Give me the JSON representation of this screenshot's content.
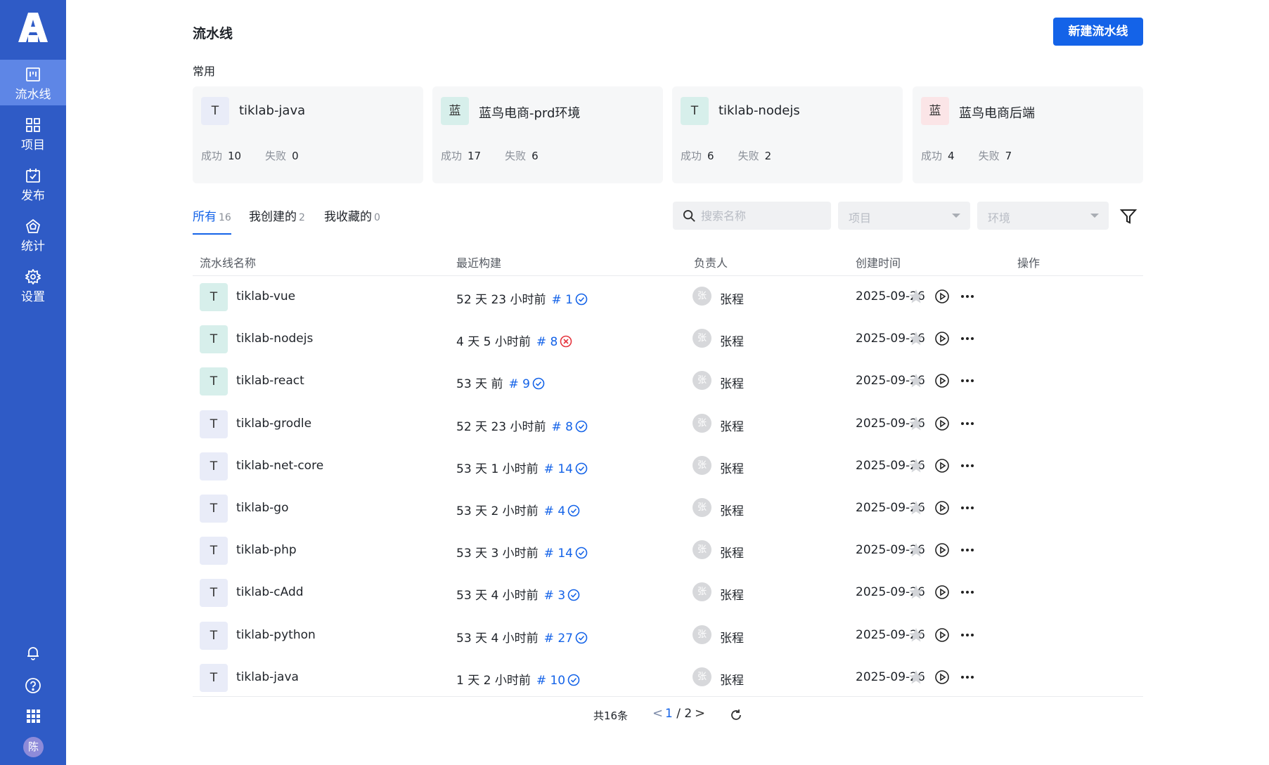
{
  "sidebar": {
    "logo": "logo-icon",
    "items": [
      {
        "label": "流水线",
        "icon": "pipeline-icon",
        "active": true
      },
      {
        "label": "项目",
        "icon": "project-grid-icon"
      },
      {
        "label": "发布",
        "icon": "release-calendar-icon"
      },
      {
        "label": "统计",
        "icon": "statistics-icon"
      },
      {
        "label": "设置",
        "icon": "gear-icon"
      }
    ],
    "bottom": [
      "bell-icon",
      "help-icon",
      "apps-grid-icon"
    ],
    "user_avatar": "陈"
  },
  "header": {
    "title": "流水线",
    "new_button": "新建流水线"
  },
  "favorites": {
    "label": "常用",
    "success_label": "成功",
    "fail_label": "失败",
    "cards": [
      {
        "initial": "T",
        "name": "tiklab-java",
        "success": "10",
        "fail": "0",
        "color": "#e9ecf8"
      },
      {
        "initial": "蓝",
        "name": "蓝鸟电商-prd环境",
        "success": "17",
        "fail": "6",
        "color": "#d7efeb"
      },
      {
        "initial": "T",
        "name": "tiklab-nodejs",
        "success": "6",
        "fail": "2",
        "color": "#d7efeb"
      },
      {
        "initial": "蓝",
        "name": "蓝鸟电商后端",
        "success": "4",
        "fail": "7",
        "color": "#fbe5e7"
      }
    ]
  },
  "tabs": [
    {
      "label": "所有",
      "count": "16",
      "active": true
    },
    {
      "label": "我创建的",
      "count": "2"
    },
    {
      "label": "我收藏的",
      "count": "0"
    }
  ],
  "filters": {
    "search_placeholder": "搜索名称",
    "project_placeholder": "项目",
    "env_placeholder": "环境"
  },
  "table": {
    "columns": [
      "流水线名称",
      "最近构建",
      "负责人",
      "创建时间",
      "操作"
    ],
    "rows": [
      {
        "initial": "T",
        "name": "tiklab-vue",
        "build_time": "52 天 23 小时前",
        "build_no": "# 1",
        "status": "success",
        "owner_initial": "张",
        "owner": "张程",
        "created": "2025-09-26",
        "color": "#d7efeb"
      },
      {
        "initial": "T",
        "name": "tiklab-nodejs",
        "build_time": "4 天 5 小时前",
        "build_no": "# 8",
        "status": "fail",
        "owner_initial": "张",
        "owner": "张程",
        "created": "2025-09-26",
        "color": "#d7efeb"
      },
      {
        "initial": "T",
        "name": "tiklab-react",
        "build_time": "53 天 前",
        "build_no": "# 9",
        "status": "success",
        "owner_initial": "张",
        "owner": "张程",
        "created": "2025-09-26",
        "color": "#d7efeb"
      },
      {
        "initial": "T",
        "name": "tiklab-grodle",
        "build_time": "52 天 23 小时前",
        "build_no": "# 8",
        "status": "success",
        "owner_initial": "张",
        "owner": "张程",
        "created": "2025-09-26",
        "color": "#e9ecf8"
      },
      {
        "initial": "T",
        "name": "tiklab-net-core",
        "build_time": "53 天 1 小时前",
        "build_no": "# 14",
        "status": "success",
        "owner_initial": "张",
        "owner": "张程",
        "created": "2025-09-26",
        "color": "#e9ecf8"
      },
      {
        "initial": "T",
        "name": "tiklab-go",
        "build_time": "53 天 2 小时前",
        "build_no": "# 4",
        "status": "success",
        "owner_initial": "张",
        "owner": "张程",
        "created": "2025-09-26",
        "color": "#e9ecf8"
      },
      {
        "initial": "T",
        "name": "tiklab-php",
        "build_time": "53 天 3 小时前",
        "build_no": "# 14",
        "status": "success",
        "owner_initial": "张",
        "owner": "张程",
        "created": "2025-09-26",
        "color": "#e9ecf8"
      },
      {
        "initial": "T",
        "name": "tiklab-cAdd",
        "build_time": "53 天 4 小时前",
        "build_no": "# 3",
        "status": "success",
        "owner_initial": "张",
        "owner": "张程",
        "created": "2025-09-26",
        "color": "#e9ecf8"
      },
      {
        "initial": "T",
        "name": "tiklab-python",
        "build_time": "53 天 4 小时前",
        "build_no": "# 27",
        "status": "success",
        "owner_initial": "张",
        "owner": "张程",
        "created": "2025-09-26",
        "color": "#e9ecf8"
      },
      {
        "initial": "T",
        "name": "tiklab-java",
        "build_time": "1 天 2 小时前",
        "build_no": "# 10",
        "status": "success",
        "owner_initial": "张",
        "owner": "张程",
        "created": "2025-09-26",
        "color": "#e9ecf8"
      }
    ]
  },
  "pagination": {
    "total": "共16条",
    "current": "1",
    "separator": " / ",
    "pages": "2"
  },
  "colors": {
    "sidebar": "#2f5bc6",
    "sidebar_active": "#5e86e6",
    "accent": "#1463e8",
    "success": "#1463e8",
    "fail": "#e5343d"
  }
}
